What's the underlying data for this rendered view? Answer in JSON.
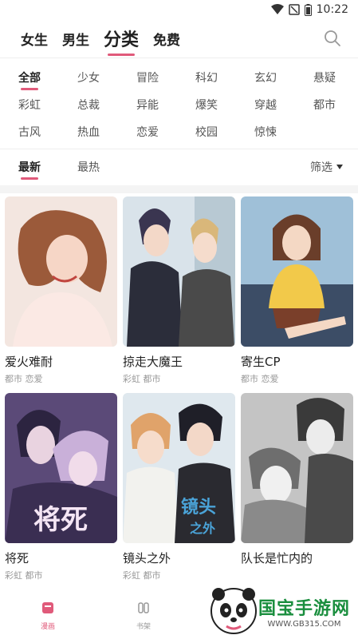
{
  "status": {
    "time": "10:22"
  },
  "topnav": {
    "tabs": [
      {
        "label": "女生"
      },
      {
        "label": "男生"
      },
      {
        "label": "分类"
      },
      {
        "label": "免费"
      }
    ]
  },
  "genres": {
    "rows": [
      [
        "全部",
        "少女",
        "冒险",
        "科幻",
        "玄幻",
        "悬疑"
      ],
      [
        "彩虹",
        "总裁",
        "异能",
        "爆笑",
        "穿越",
        "都市"
      ],
      [
        "古风",
        "热血",
        "恋爱",
        "校园",
        "惊悚"
      ]
    ]
  },
  "sort": {
    "latest": "最新",
    "hottest": "最热",
    "filter": "筛选"
  },
  "comics": [
    {
      "title": "爱火难耐",
      "tags": "都市 恋爱"
    },
    {
      "title": "掠走大魔王",
      "tags": "彩虹 都市"
    },
    {
      "title": "寄生CP",
      "tags": "都市 恋爱"
    },
    {
      "title": "将死",
      "tags": "彩虹 都市"
    },
    {
      "title": "镜头之外",
      "tags": "彩虹 都市"
    },
    {
      "title": "队长是忙内的",
      "tags": ""
    }
  ],
  "cover_texts": {
    "c4": "将死",
    "c5a": "镜头",
    "c5b": "之外"
  },
  "bottomnav": {
    "comics": "漫画",
    "shelf": "书架"
  },
  "watermark": {
    "name": "国宝手游网",
    "url": "WWW.GB315.COM"
  },
  "colors": {
    "accent": "#e05a7a",
    "watermark": "#1a8e3e"
  }
}
